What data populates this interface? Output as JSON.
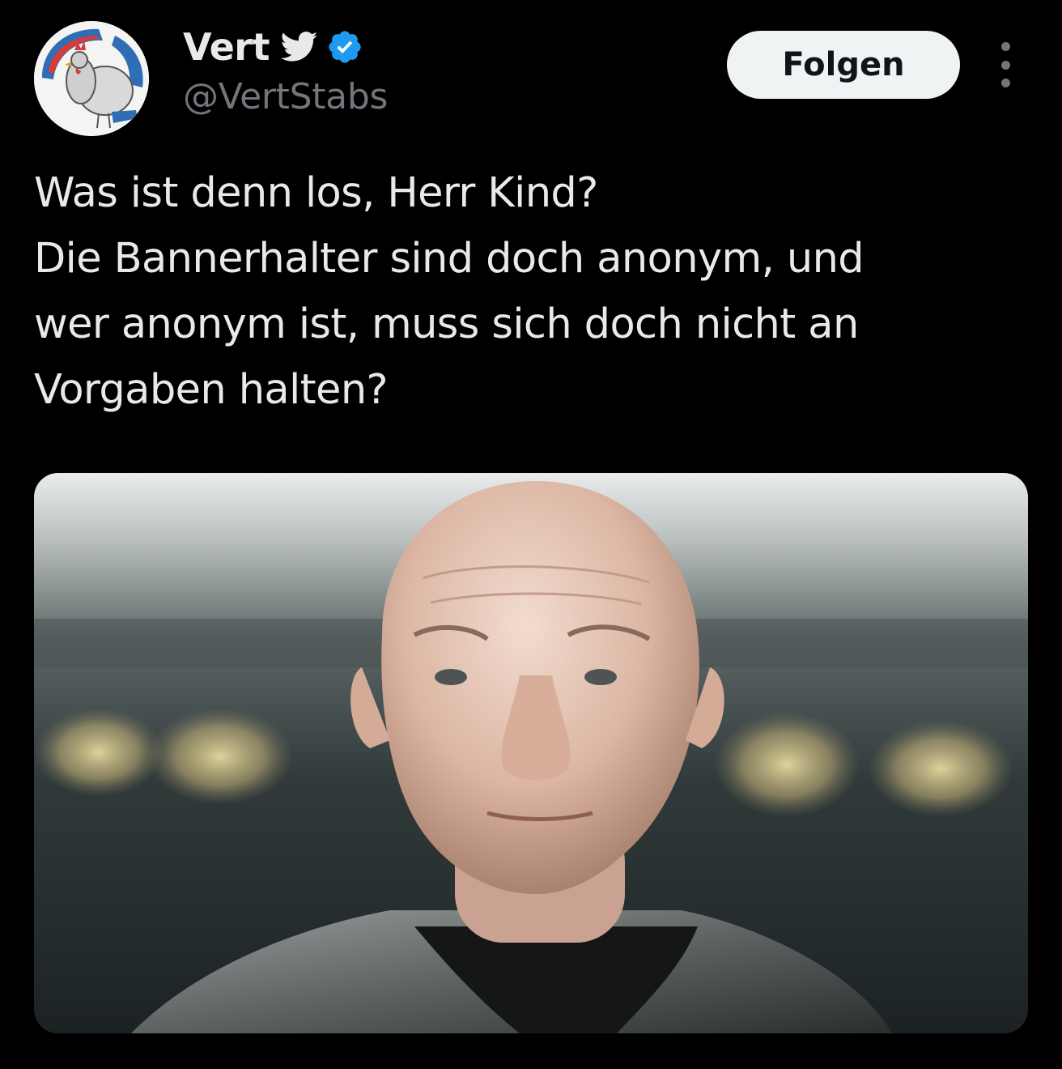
{
  "author": {
    "display_name": "Vert",
    "handle": "@VertStabs",
    "verified": true,
    "avatar": "rooster-avatar",
    "badge_icon": "twitter-bird-icon"
  },
  "actions": {
    "follow_label": "Folgen",
    "more_icon": "more-options-icon"
  },
  "tweet": {
    "text_lines": [
      "Was ist denn los, Herr Kind?",
      "Die Bannerhalter sind doch anonym, und",
      "wer anonym ist, muss sich doch nicht an",
      "Vorgaben halten?"
    ]
  },
  "media": {
    "kind": "photo",
    "subject": "portrait-photo"
  },
  "colors": {
    "background": "#000000",
    "text_primary": "#e7e9ea",
    "text_secondary": "#71767b",
    "verified_blue": "#1d9bf0",
    "follow_button_bg": "#eff3f4",
    "follow_button_text": "#0f1419"
  }
}
